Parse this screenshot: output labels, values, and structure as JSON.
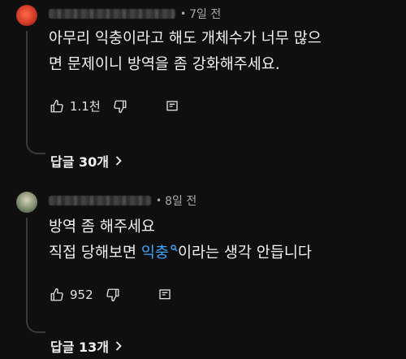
{
  "comments": [
    {
      "timestamp": "7일 전",
      "text_line1": "아무리 익충이라고 해도 개체수가 너무 많으",
      "text_line2": "면 문제이니 방역을 좀 강화해주세요.",
      "likes": "1.1천",
      "replies_label": "답글 30개"
    },
    {
      "timestamp": "8일 전",
      "text_line1": "방역 좀 해주세요",
      "text_line2_pre": "직접 당해보면 ",
      "text_line2_link": "익충",
      "text_line2_post": "이라는 생각 안듭니다",
      "likes": "952",
      "replies_label": "답글 13개"
    }
  ],
  "separator": "•",
  "colors": {
    "background": "#0f0f0f",
    "text": "#f1f1f1",
    "secondary": "#aaaaaa",
    "link": "#3ea6ff"
  },
  "icons": [
    "thumb-up-icon",
    "thumb-down-icon",
    "reply-icon",
    "chevron-right-icon",
    "search-icon"
  ]
}
